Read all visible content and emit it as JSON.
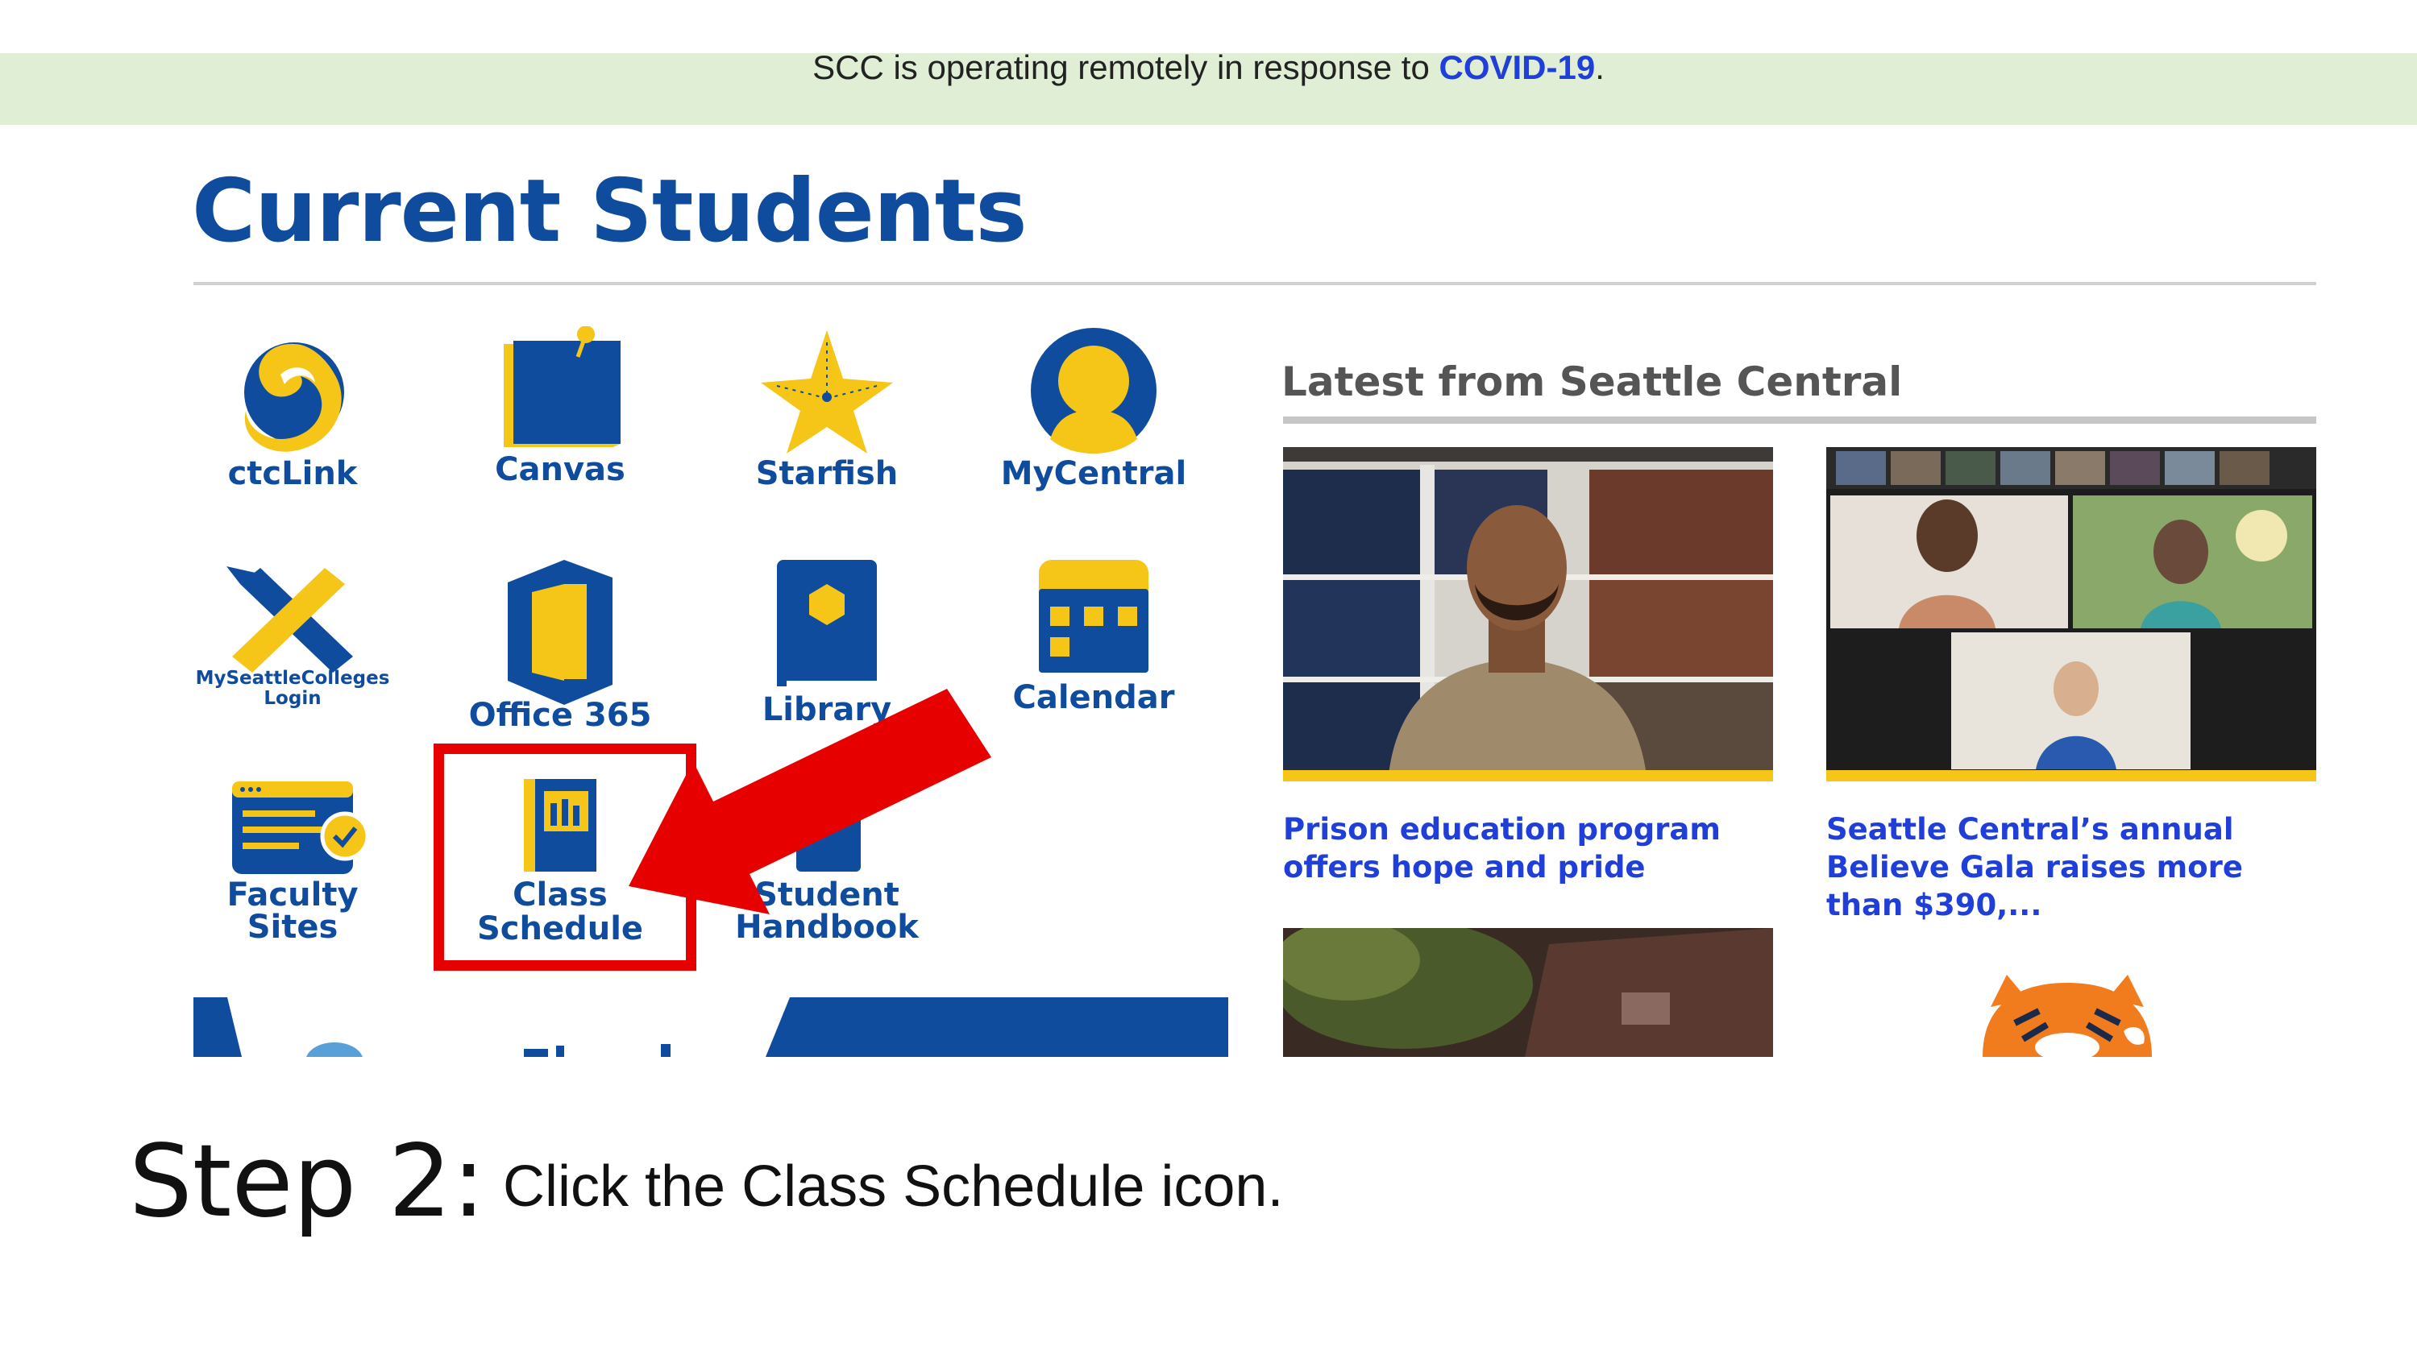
{
  "banner": {
    "text": "SCC is operating remotely in response to ",
    "link": "COVID-19",
    "suffix": "."
  },
  "page_title": "Current Students",
  "tiles": [
    {
      "label": "ctcLink",
      "icon": "ctclink-swirl-icon"
    },
    {
      "label": "Canvas",
      "icon": "canvas-note-icon"
    },
    {
      "label": "Starfish",
      "icon": "starfish-icon"
    },
    {
      "label": "MyCentral",
      "icon": "user-avatar-icon"
    },
    {
      "label_line1": "MySeattleColleges",
      "label_line2": "Login",
      "icon": "pencil-cross-icon"
    },
    {
      "label": "Office 365",
      "icon": "office-door-icon"
    },
    {
      "label": "Library",
      "icon": "book-icon"
    },
    {
      "label": "Calendar",
      "icon": "calendar-icon"
    },
    {
      "label_line1": "Faculty",
      "label_line2": "Sites",
      "icon": "faculty-sites-icon"
    },
    {
      "label_line1": "Class",
      "label_line2": "Schedule",
      "icon": "class-schedule-book-icon"
    },
    {
      "label_line1": "Student",
      "label_line2": "Handbook",
      "icon": "handbook-icon"
    }
  ],
  "news": {
    "heading": "Latest from Seattle Central",
    "items": [
      {
        "title": "Prison education program offers hope and pride"
      },
      {
        "title": "Seattle Central’s annual Believe Gala raises more than $390,..."
      }
    ]
  },
  "instruction": {
    "step": "Step 2:",
    "pre": "Click the ",
    "emphasis": "Class Schedule",
    "post": " icon."
  },
  "colors": {
    "brand_blue": "#0f4c9e",
    "brand_yellow": "#f5c518",
    "link_blue": "#1f3fd8",
    "highlight_red": "#e60000",
    "banner_green": "#dfeed5"
  }
}
